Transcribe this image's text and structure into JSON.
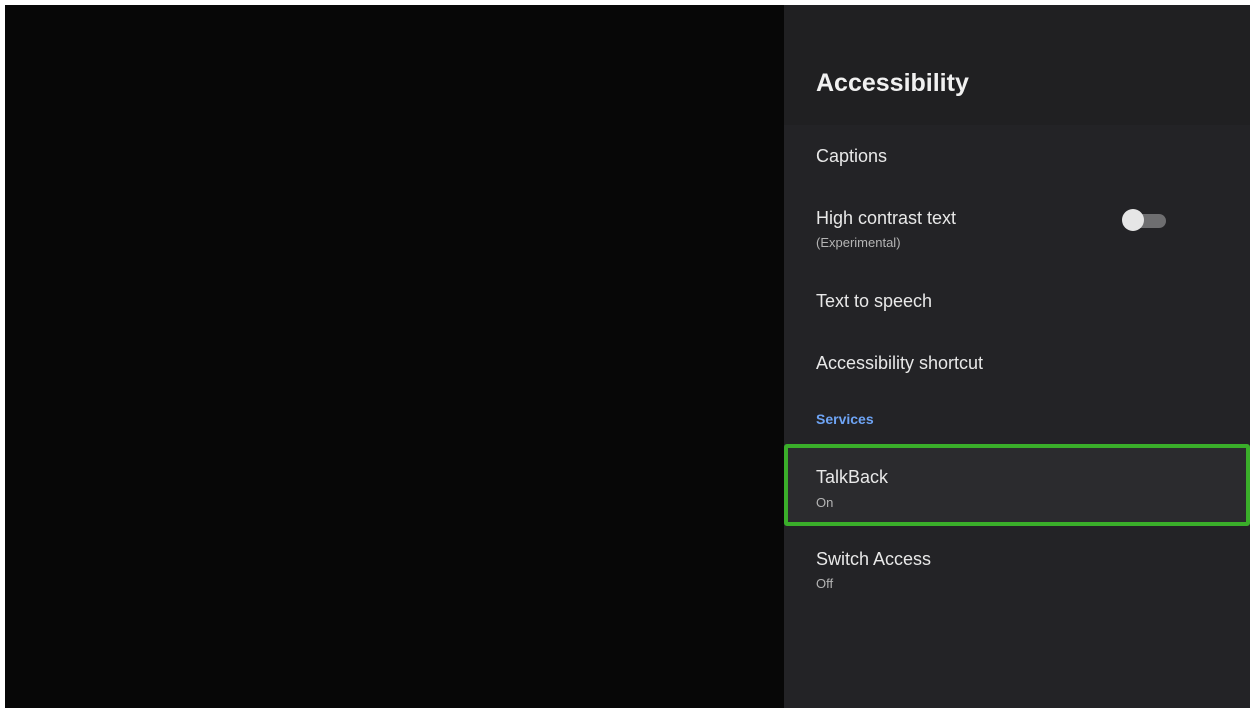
{
  "panel": {
    "title": "Accessibility",
    "items": [
      {
        "label": "Captions"
      },
      {
        "label": "High contrast text",
        "sub": "(Experimental)",
        "toggle_state": "off"
      },
      {
        "label": "Text to speech"
      },
      {
        "label": "Accessibility shortcut"
      }
    ],
    "section_label": "Services",
    "services": [
      {
        "label": "TalkBack",
        "status": "On",
        "focused": true
      },
      {
        "label": "Switch Access",
        "status": "Off"
      }
    ]
  },
  "colors": {
    "background": "#060606",
    "panel": "#232326",
    "accent_blue": "#6ea4f5",
    "focus_green": "#3aae2a"
  },
  "icons": [
    "toggle-switch-icon"
  ]
}
